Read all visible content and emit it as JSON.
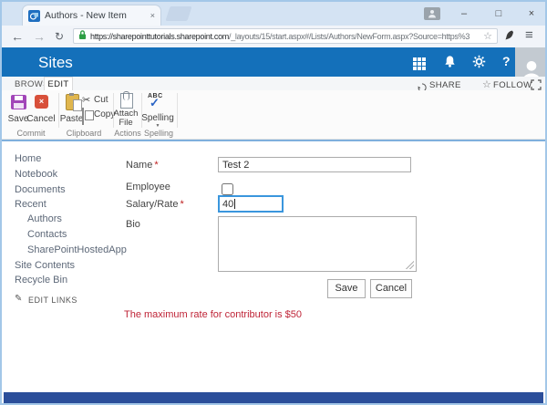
{
  "browser": {
    "tab_title": "Authors - New Item",
    "url_host": "https://sharepointtutorials.sharepoint.com",
    "url_path": "/_layouts/15/start.aspx#/Lists/Authors/NewForm.aspx?Source=https%3"
  },
  "suite_bar": {
    "title": "Sites"
  },
  "ribbon": {
    "tabs": [
      {
        "label": "BROWSE"
      },
      {
        "label": "EDIT"
      }
    ],
    "share_label": "SHARE",
    "follow_label": "FOLLOW",
    "buttons": {
      "save": "Save",
      "cancel": "Cancel",
      "paste": "Paste",
      "cut": "Cut",
      "copy": "Copy",
      "attach_line1": "Attach",
      "attach_line2": "File",
      "spelling": "Spelling"
    },
    "group_labels": {
      "commit": "Commit",
      "clipboard": "Clipboard",
      "actions": "Actions",
      "spelling": "Spelling"
    }
  },
  "sidebar": {
    "items": [
      {
        "label": "Home"
      },
      {
        "label": "Notebook"
      },
      {
        "label": "Documents"
      },
      {
        "label": "Recent"
      },
      {
        "label": "Authors"
      },
      {
        "label": "Contacts"
      },
      {
        "label": "SharePointHostedApp"
      },
      {
        "label": "Site Contents"
      },
      {
        "label": "Recycle Bin"
      }
    ],
    "edit_links_label": "EDIT LINKS"
  },
  "form": {
    "required_mark": "*",
    "fields": {
      "name": {
        "label": "Name",
        "value": "Test 2"
      },
      "employee": {
        "label": "Employee",
        "checked": false
      },
      "salary": {
        "label": "Salary/Rate",
        "value": "40"
      },
      "bio": {
        "label": "Bio",
        "value": ""
      }
    },
    "save_label": "Save",
    "cancel_label": "Cancel",
    "validation_message": "The maximum rate for contributor is $50"
  },
  "icons": {
    "close_x": "×",
    "minimize": "–",
    "maximize": "□",
    "back": "←",
    "forward": "→",
    "refresh": "↻",
    "bookmark_star": "☆",
    "menu": "≡",
    "help": "?",
    "cut_scissors": "✂",
    "follow_star": "☆",
    "pencil": "✎",
    "caret_down": "▼",
    "check": "✓",
    "spelling_abc": "ABC"
  },
  "colors": {
    "suite_bar_blue": "#1470ba",
    "focus_border_blue": "#3a96dd",
    "validation_red": "#bf2437",
    "footer_blue": "#2b4e9a",
    "save_icon_purple": "#a246b8",
    "cancel_icon_red": "#d8503a"
  }
}
